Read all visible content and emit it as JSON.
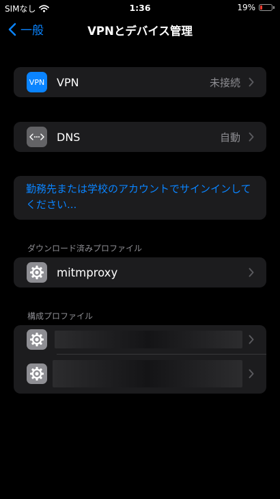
{
  "status": {
    "carrier": "SIMなし",
    "time": "1:36",
    "battery_percent_label": "19%",
    "battery_level": 0.19,
    "battery_color": "#ff3b30"
  },
  "nav": {
    "back_label": "一般",
    "title": "VPNとデバイス管理"
  },
  "vpn": {
    "icon_text": "VPN",
    "label": "VPN",
    "value": "未接続",
    "icon_color": "#0a84ff"
  },
  "dns": {
    "label": "DNS",
    "value": "自動"
  },
  "signin": {
    "text": "勤務先または学校のアカウントでサインインしてください..."
  },
  "downloaded": {
    "header": "ダウンロード済みプロファイル",
    "items": [
      {
        "label": "mitmproxy"
      }
    ]
  },
  "config": {
    "header": "構成プロファイル"
  },
  "colors": {
    "accent": "#0a84ff",
    "group_bg": "#1c1c1e",
    "secondary_text": "#8e8e93"
  },
  "icons": [
    "wifi-icon",
    "battery-icon",
    "chevron-left-icon",
    "vpn-icon",
    "dns-icon",
    "gear-icon",
    "chevron-right-icon"
  ]
}
